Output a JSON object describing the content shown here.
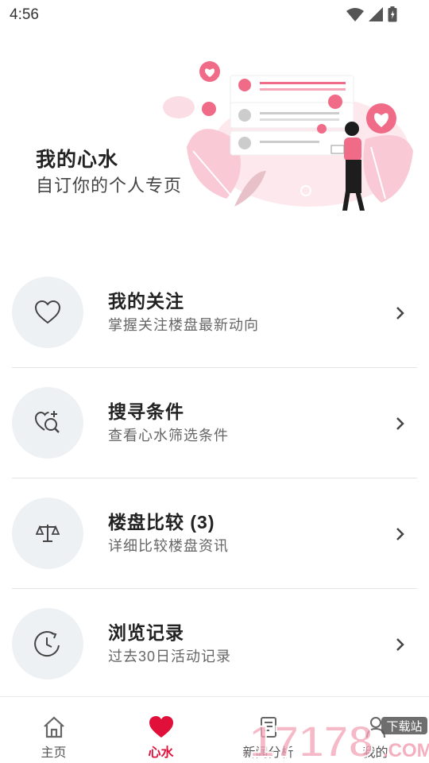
{
  "status_bar": {
    "time": "4:56"
  },
  "header": {
    "title": "我的心水",
    "subtitle": "自订你的个人专页"
  },
  "menu": [
    {
      "title": "我的关注",
      "desc": "掌握关注楼盘最新动向",
      "icon": "heart-outline-icon"
    },
    {
      "title": "搜寻条件",
      "desc": "查看心水筛选条件",
      "icon": "heart-search-icon"
    },
    {
      "title": "楼盘比较 (3)",
      "desc": "详细比较楼盘资讯",
      "icon": "balance-scale-icon"
    },
    {
      "title": "浏览记录",
      "desc": "过去30日活动记录",
      "icon": "history-clock-icon"
    }
  ],
  "nav": {
    "items": [
      {
        "label": "主页",
        "icon": "home-icon"
      },
      {
        "label": "心水",
        "icon": "heart-filled-icon",
        "active": true
      },
      {
        "label": "新闻分析",
        "icon": "news-icon"
      },
      {
        "label": "我的",
        "icon": "user-icon"
      }
    ]
  },
  "watermark": {
    "brand": "17178",
    "tag": "下载站",
    "domain": ".COM"
  },
  "colors": {
    "accent": "#e0103a",
    "hero_pink": "#f06b87",
    "circle_bg": "#eef1f3"
  }
}
